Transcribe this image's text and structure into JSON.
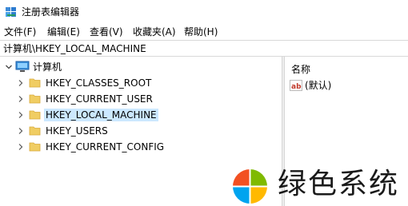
{
  "window": {
    "title": "注册表编辑器"
  },
  "menu": [
    {
      "label": "文件(F)"
    },
    {
      "label": "编辑(E)"
    },
    {
      "label": "查看(V)"
    },
    {
      "label": "收藏夹(A)"
    },
    {
      "label": "帮助(H)"
    }
  ],
  "address": {
    "path": "计算机\\HKEY_LOCAL_MACHINE"
  },
  "tree": {
    "root": {
      "label": "计算机",
      "expanded": true
    },
    "hives": [
      {
        "label": "HKEY_CLASSES_ROOT",
        "selected": false
      },
      {
        "label": "HKEY_CURRENT_USER",
        "selected": false
      },
      {
        "label": "HKEY_LOCAL_MACHINE",
        "selected": true
      },
      {
        "label": "HKEY_USERS",
        "selected": false
      },
      {
        "label": "HKEY_CURRENT_CONFIG",
        "selected": false
      }
    ]
  },
  "values": {
    "column_name": "名称",
    "rows": [
      {
        "name": "(默认)",
        "icon": "string-value-icon"
      }
    ]
  },
  "watermark": {
    "text": "绿色系统",
    "logo_colors": [
      "#f25022",
      "#7fba00",
      "#00a4ef",
      "#ffb900"
    ]
  },
  "colors": {
    "selection": "#cce8ff",
    "folder": "#e9c46a"
  }
}
